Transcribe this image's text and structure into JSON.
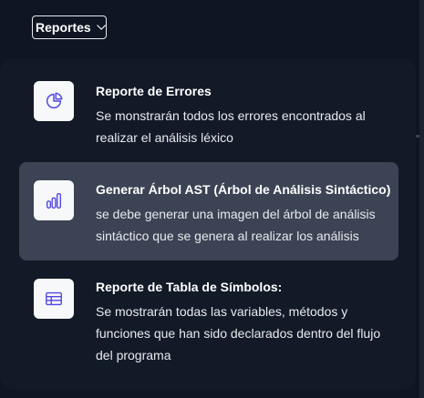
{
  "dropdown": {
    "label": "Reportes",
    "icon": "chevron-down-icon"
  },
  "menu": {
    "items": [
      {
        "title": "Reporte de Errores",
        "description": "Se monstrarán todos los errores encontrados al realizar el análisis léxico",
        "icon": "pie-chart-icon",
        "active": false
      },
      {
        "title": "Generar Árbol AST (Árbol de Análisis Sintáctico)",
        "description": "se debe generar una imagen del árbol de análisis sintáctico que se genera al realizar los análisis",
        "icon": "bar-chart-icon",
        "active": true
      },
      {
        "title": "Reporte de Tabla de Símbolos:",
        "description": "Se mostrarán todas las variables, métodos y funciones que han sido declarados dentro del flujo del programa",
        "icon": "table-icon",
        "active": false
      }
    ]
  },
  "colors": {
    "background": "#0f1623",
    "panel": "#121a28",
    "active_item": "#3b4354",
    "icon_accent": "#4f46e5",
    "icon_box": "#f7f8fa"
  }
}
